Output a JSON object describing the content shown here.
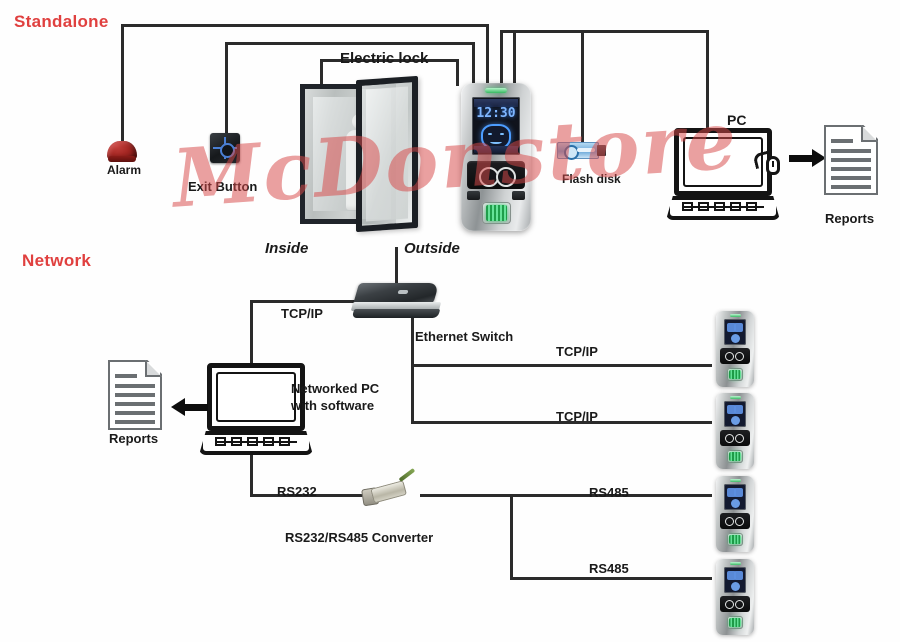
{
  "diagram": {
    "sections": [
      {
        "id": "standalone",
        "label": "Standalone",
        "color": "#e0403f"
      },
      {
        "id": "network",
        "label": "Network",
        "color": "#e0403f"
      }
    ],
    "watermark": "McDonstore"
  },
  "standalone": {
    "alarm_label": "Alarm",
    "exit_button_label": "Exit Button",
    "electric_lock_label": "Electric lock",
    "inside_label": "Inside",
    "outside_label": "Outside",
    "flash_disk_label": "Flash disk",
    "pc_label": "PC",
    "reports_label": "Reports",
    "terminal_clock": "12:30"
  },
  "network": {
    "tcpip_label": "TCP/IP",
    "ethernet_switch_label": "Ethernet Switch",
    "networked_pc_label_line1": "Networked PC",
    "networked_pc_label_line2": "with software",
    "reports_label": "Reports",
    "rs232_label": "RS232",
    "converter_label": "RS232/RS485 Converter",
    "links": [
      {
        "id": "switch-dev-1",
        "label": "TCP/IP"
      },
      {
        "id": "switch-dev-2",
        "label": "TCP/IP"
      },
      {
        "id": "conv-dev-3",
        "label": "RS485"
      },
      {
        "id": "conv-dev-4",
        "label": "RS485"
      }
    ]
  }
}
